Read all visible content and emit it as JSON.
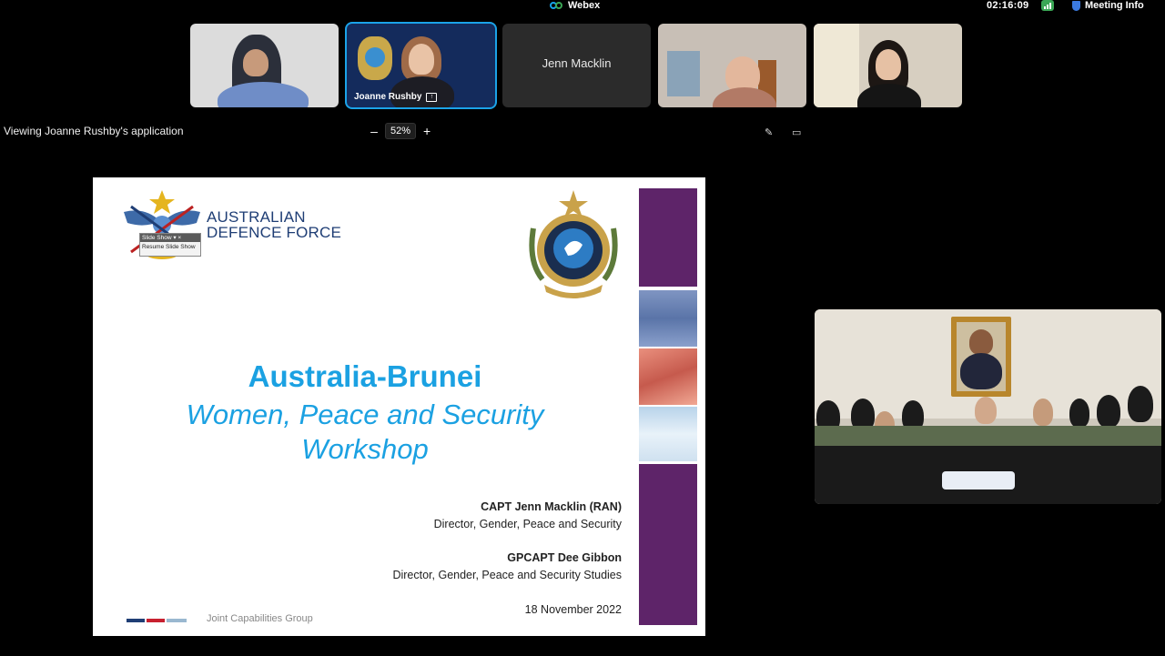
{
  "app": {
    "name": "Webex",
    "clock": "02:16:09",
    "meeting_info": "Meeting Info"
  },
  "participants": [
    {
      "name": "",
      "video": true
    },
    {
      "name": "Joanne Rushby",
      "video": true,
      "sharing": true,
      "active_speaker": true
    },
    {
      "name": "Jenn Macklin",
      "video": false
    },
    {
      "name": "",
      "video": true
    },
    {
      "name": "",
      "video": true
    }
  ],
  "share_bar": {
    "viewing_text": "Viewing Joanne Rushby's application",
    "zoom": "52%",
    "zoom_out": "–",
    "zoom_in": "+"
  },
  "slide": {
    "org_name_line1": "AUSTRALIAN",
    "org_name_line2": "DEFENCE FORCE",
    "title": "Australia-Brunei",
    "subtitle_line1": "Women, Peace and Security",
    "subtitle_line2": "Workshop",
    "presenter1_name": "CAPT Jenn Macklin (RAN)",
    "presenter1_role": "Director, Gender, Peace and Security",
    "presenter2_name": "GPCAPT Dee Gibbon",
    "presenter2_role": "Director, Gender, Peace and Security Studies",
    "date": "18 November 2022",
    "footer_group": "Joint Capabilities Group",
    "slideshow_popup": {
      "title": "Slide Show",
      "item": "Resume Slide Show"
    }
  },
  "colors": {
    "accent_blue": "#1ba1e2",
    "purple": "#5e2469",
    "navy": "#1f3e75",
    "webex_blue": "#1ba3e8"
  }
}
